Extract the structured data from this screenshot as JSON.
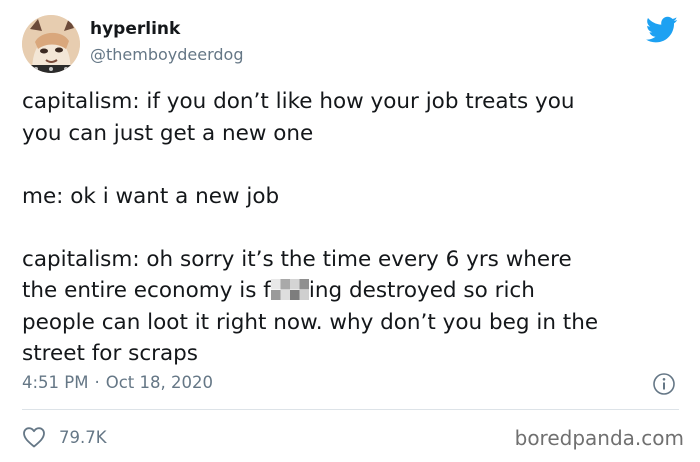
{
  "user": {
    "display_name": "hyperlink",
    "handle": "@themboydeerdog",
    "avatar": "cartoon-deer-avatar"
  },
  "platform_icon": "twitter-bird-icon",
  "tweet": {
    "para1": "capitalism: if you don’t like how your job treats you\nyou can just get a new one",
    "para2": "me: ok i want a new job",
    "para3_line1": "capitalism: oh sorry it’s the time every 6 yrs where",
    "para3_line2_before": "the entire economy is f",
    "para3_line2_after": "ing destroyed so rich",
    "para3_rest": "people can loot it right now. why don’t you beg in the\nstreet for scraps"
  },
  "meta": {
    "time": "4:51 PM",
    "separator": "·",
    "date": "Oct 18, 2020"
  },
  "actions": {
    "like_count": "79.7K"
  },
  "watermark": "boredpanda.com",
  "colors": {
    "text": "#14171a",
    "secondary": "#657786",
    "twitter_blue": "#1da1f2",
    "divider": "#dde3e8"
  }
}
